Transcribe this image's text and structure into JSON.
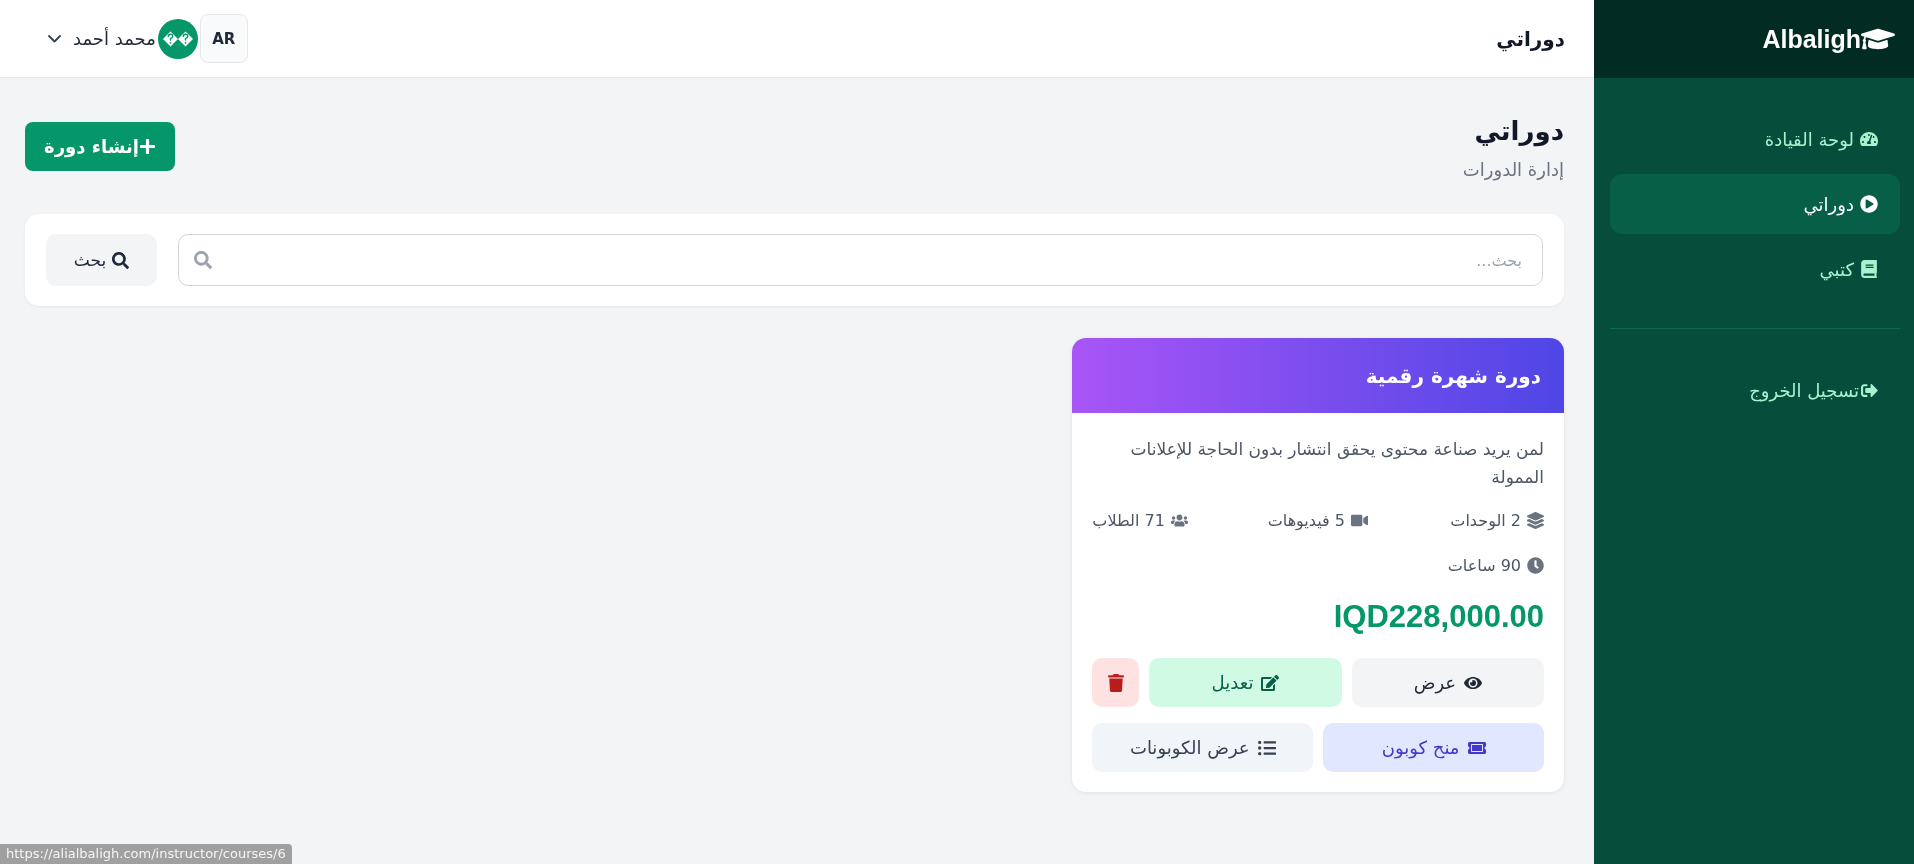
{
  "sidebar": {
    "logo": "Albaligh",
    "items": [
      {
        "kind": "dashboard",
        "label": "لوحة القيادة",
        "selected": false
      },
      {
        "kind": "courses",
        "label": "دوراتي",
        "selected": true
      },
      {
        "kind": "books",
        "label": "كتبي",
        "selected": false
      }
    ],
    "logout": "تسجيل الخروج"
  },
  "topbar": {
    "title": "دوراتي",
    "language": "AR",
    "user_name": "محمد أحمد"
  },
  "page": {
    "title": "دوراتي",
    "subtitle": "إدارة الدورات",
    "create_button": "إنشاء دورة"
  },
  "search": {
    "placeholder": "بحث...",
    "button": "بحث"
  },
  "courses": [
    {
      "title": "دورة شهرة رقمية",
      "description": "لمن يريد صناعة محتوى يحقق انتشار بدون الحاجة للإعلانات الممولة",
      "stats": [
        {
          "kind": "units",
          "text": "2 الوحدات"
        },
        {
          "kind": "videos",
          "text": "5 فيديوهات"
        },
        {
          "kind": "students",
          "text": "71 الطلاب"
        },
        {
          "kind": "hours",
          "text": "90 ساعات"
        }
      ],
      "price": "IQD228,000.00",
      "action_rows": [
        [
          {
            "kind": "view",
            "label": "عرض"
          },
          {
            "kind": "edit",
            "label": "تعديل"
          },
          {
            "kind": "delete"
          }
        ],
        [
          {
            "kind": "grant_coupon",
            "label": "منح كوبون"
          },
          {
            "kind": "coupons",
            "label": "عرض الكوبونات"
          }
        ]
      ]
    }
  ],
  "status_bar": {
    "url": "https://alialbaligh.com/instructor/courses/6"
  }
}
